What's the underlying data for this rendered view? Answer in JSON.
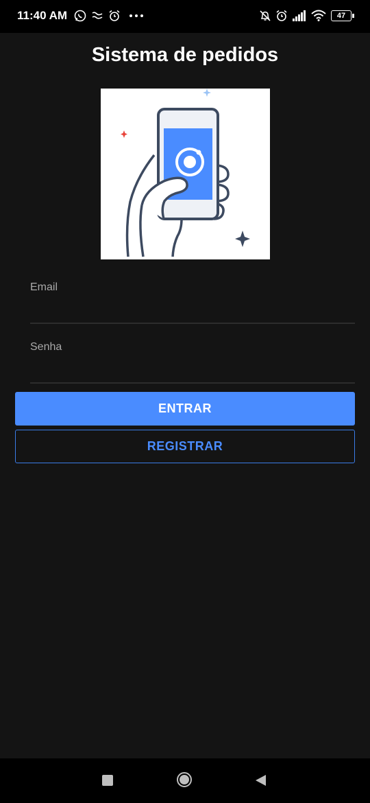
{
  "status_bar": {
    "time": "11:40 AM",
    "battery_level": "47",
    "icons": [
      "whatsapp-icon",
      "notification-icon",
      "alarm-icon",
      "more-icon",
      "mute-icon",
      "alarm-icon",
      "signal-icon",
      "wifi-icon",
      "battery-icon"
    ]
  },
  "header": {
    "title": "Sistema de pedidos"
  },
  "hero": {
    "icon": "hand-holding-phone-illustration"
  },
  "form": {
    "email_label": "Email",
    "email_value": "",
    "password_label": "Senha",
    "password_value": ""
  },
  "actions": {
    "login_label": "ENTRAR",
    "register_label": "REGISTRAR"
  },
  "navigation": {
    "icons": [
      "recent-apps-icon",
      "home-icon",
      "back-icon"
    ]
  },
  "colors": {
    "background": "#141414",
    "accent": "#4a8cff",
    "status_bar": "#000000"
  }
}
